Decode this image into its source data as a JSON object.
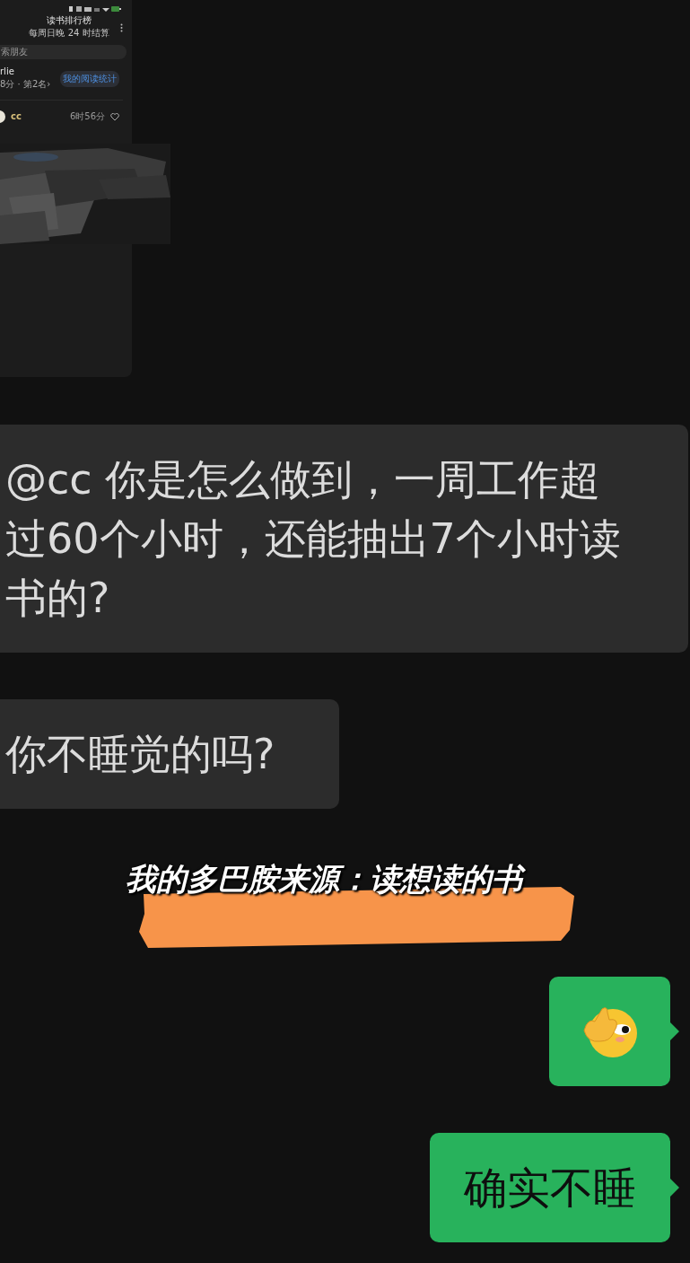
{
  "shared_screenshot": {
    "title": "读书排行榜",
    "subtitle": "每周日晚 24 时结算",
    "search_placeholder": "索朋友",
    "user_name": "rlie",
    "user_stats": "8分 · 第2名›",
    "stats_button": "我的阅读统计",
    "entries": [
      {
        "name": "cc",
        "time": "6时56分"
      }
    ]
  },
  "messages": [
    {
      "outgoing": false,
      "kind": "text",
      "text": "@cc 你是怎么做到，一周工作超过60个小时，还能抽出7个小时读书的?"
    },
    {
      "outgoing": false,
      "kind": "text",
      "text": "你不睡觉的吗?"
    },
    {
      "kind": "caption",
      "text": "我的多巴胺来源：读想读的书"
    },
    {
      "outgoing": true,
      "kind": "emoji"
    },
    {
      "outgoing": true,
      "kind": "text",
      "text": "确实不睡"
    }
  ]
}
